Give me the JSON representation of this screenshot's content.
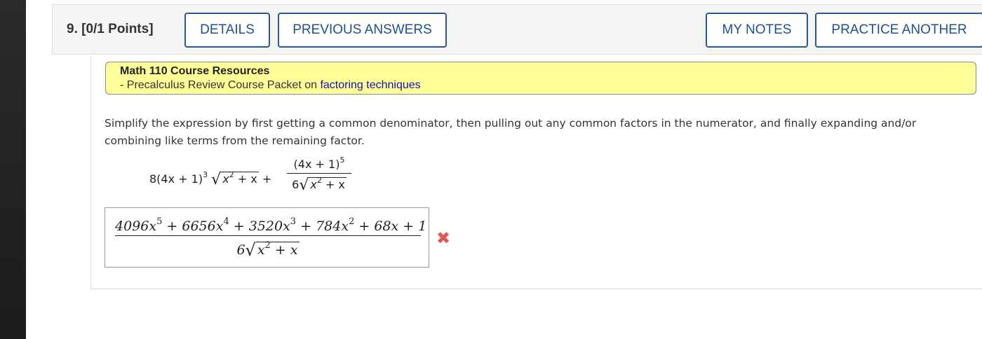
{
  "header": {
    "question": "9. [0/1 Points]",
    "details_label": "DETAILS",
    "previous_answers_label": "PREVIOUS ANSWERS",
    "my_notes_label": "MY NOTES",
    "practice_another_label": "PRACTICE ANOTHER"
  },
  "resources": {
    "title": "Math 110 Course Resources",
    "line_prefix": "- Precalculus Review Course Packet on ",
    "link_text": "factoring techniques"
  },
  "prompt": "Simplify the expression by first getting a common denominator, then pulling out any common factors in the numerator, and finally expanding and/or combining like terms from the remaining factor.",
  "expression": {
    "term1_coef": "8(4x + 1)",
    "term1_exp": "3",
    "radicand": "x",
    "radicand_exp": "2",
    "radicand_tail": " + x",
    "plus": "+",
    "frac_num_base": "(4x + 1)",
    "frac_num_exp": "5",
    "frac_den_coef": "6"
  },
  "answer": {
    "n1": "4096x",
    "n1e": "5",
    "n2": " + 6656x",
    "n2e": "4",
    "n3": " + 3520x",
    "n3e": "3",
    "n4": " + 784x",
    "n4e": "2",
    "n5": " + 68x + 1",
    "den_coef": "6",
    "den_rad": "x",
    "den_rad_exp": "2",
    "den_rad_tail": " + x",
    "status_icon": "incorrect-icon",
    "status_color": "#e25555"
  }
}
